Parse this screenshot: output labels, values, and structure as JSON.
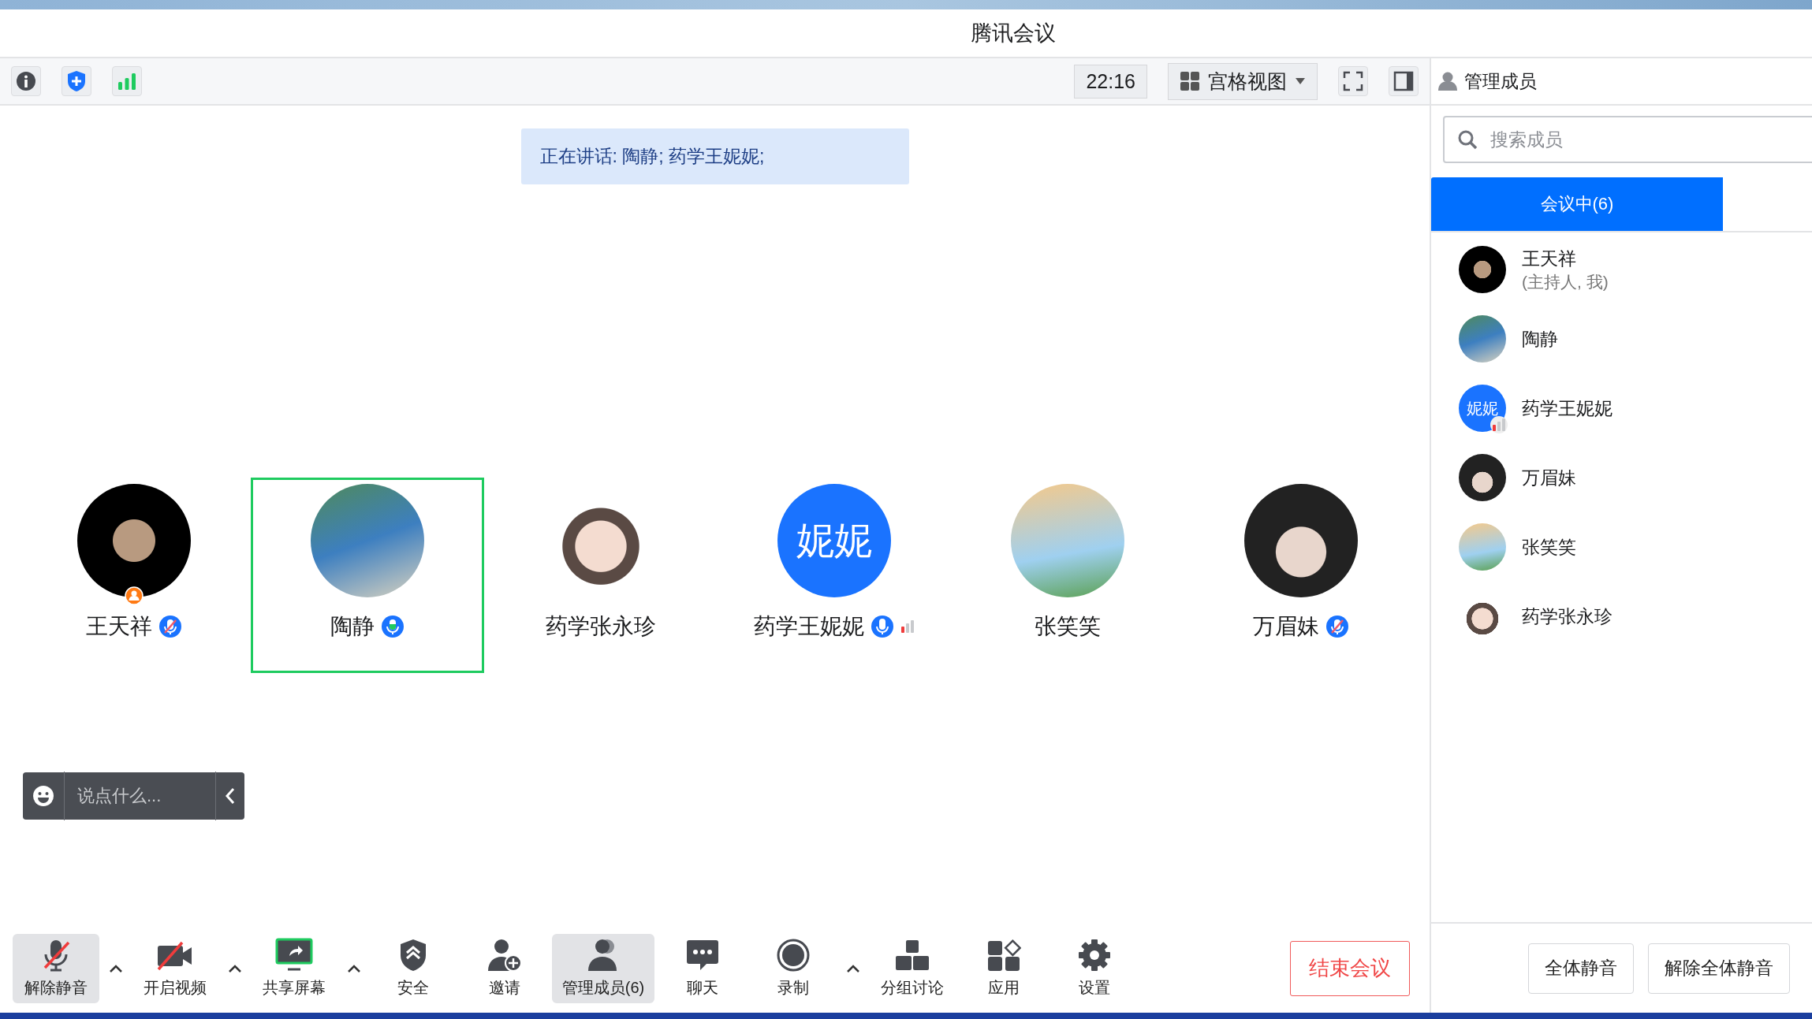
{
  "window": {
    "title": "腾讯会议"
  },
  "toolbar": {
    "time": "22:16",
    "view_menu": {
      "label": "宫格视图"
    }
  },
  "speaking_banner": "正在讲话: 陶静; 药学王妮妮;",
  "participants": [
    {
      "name": "王天祥",
      "host": true,
      "kind": "muted",
      "signal": false,
      "selected": false
    },
    {
      "name": "陶静",
      "host": false,
      "kind": "speaking",
      "signal": false,
      "selected": true
    },
    {
      "name": "药学张永珍",
      "host": false,
      "kind": "silent",
      "signal": false,
      "selected": false
    },
    {
      "name": "药学王妮妮",
      "initials": "妮妮",
      "host": false,
      "kind": "open",
      "signal": true,
      "selected": false
    },
    {
      "name": "张笑笑",
      "host": false,
      "kind": "silent",
      "signal": false,
      "selected": false
    },
    {
      "name": "万眉妹",
      "host": false,
      "kind": "muted",
      "signal": false,
      "selected": false
    }
  ],
  "chat_input": {
    "placeholder": "说点什么..."
  },
  "controls": [
    {
      "kind": "button",
      "label": "解除静音",
      "selected": true
    },
    {
      "kind": "caret"
    },
    {
      "kind": "button",
      "label": "开启视频",
      "selected": false
    },
    {
      "kind": "caret"
    },
    {
      "kind": "button",
      "label": "共享屏幕",
      "selected": false
    },
    {
      "kind": "caret"
    },
    {
      "kind": "button",
      "label": "安全",
      "selected": false
    },
    {
      "kind": "button",
      "label": "邀请",
      "selected": false
    },
    {
      "kind": "button",
      "label": "管理成员(6)",
      "selected": true
    },
    {
      "kind": "button",
      "label": "聊天",
      "selected": false
    },
    {
      "kind": "button",
      "label": "录制",
      "selected": false
    },
    {
      "kind": "caret"
    },
    {
      "kind": "button",
      "label": "分组讨论",
      "selected": false
    },
    {
      "kind": "button",
      "label": "应用",
      "selected": false
    },
    {
      "kind": "button",
      "label": "设置",
      "selected": false
    }
  ],
  "end_button": "结束会议",
  "sidebar": {
    "title": "管理成员",
    "search": {
      "placeholder": "搜索成员"
    },
    "tabs": [
      {
        "label": "会议中(6)",
        "selected": true
      }
    ],
    "members": [
      {
        "name": "王天祥",
        "note": "(主持人, 我)",
        "signal": false
      },
      {
        "name": "陶静",
        "signal": false
      },
      {
        "name": "药学王妮妮",
        "initials": "妮妮",
        "signal": true
      },
      {
        "name": "万眉妹",
        "signal": false
      },
      {
        "name": "张笑笑",
        "signal": false
      },
      {
        "name": "药学张永珍",
        "signal": false
      }
    ],
    "buttons": [
      "全体静音",
      "解除全体静音"
    ]
  }
}
